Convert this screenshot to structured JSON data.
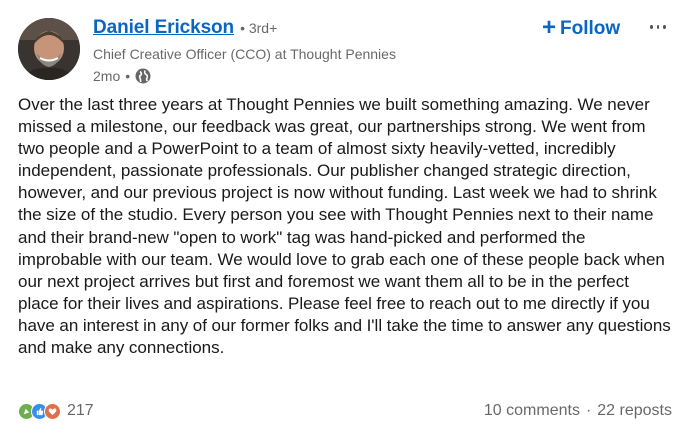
{
  "actor": {
    "name": "Daniel Erickson",
    "degree": "• 3rd+",
    "headline": "Chief Creative Officer (CCO) at Thought Pennies",
    "time": "2mo",
    "visibility_separator": "•"
  },
  "actions": {
    "follow_label": "Follow",
    "follow_icon": "+",
    "more_icon": "more-dots-icon"
  },
  "post": {
    "text": "Over the last three years at Thought Pennies we built something amazing. We never missed a milestone, our feedback was great, our partnerships strong. We went from two people and a PowerPoint to a team of almost sixty heavily-vetted, incredibly independent, passionate professionals. Our publisher changed strategic direction, however, and our previous project is now without funding. Last week we had to shrink the size of the studio. Every person you see with Thought Pennies next to their name and their brand-new \"open to work\" tag was hand-picked and performed the improbable with our team. We would love to grab each one of these people back when our next project arrives but first and foremost we want them all to be in the perfect place for their lives and aspirations. Please feel free to reach out to me directly if you have an interest in any of our former folks and I'll take the time to answer any questions and make any connections."
  },
  "social": {
    "reaction_count": "217",
    "reactions": [
      "celebrate-icon",
      "like-icon",
      "love-icon"
    ],
    "comments": "10 comments",
    "separator": "·",
    "reposts": "22 reposts"
  },
  "colors": {
    "link_blue": "#0a66c2",
    "secondary_text": "#666666",
    "celebrate": "#6dae4f",
    "like": "#378fe9",
    "love": "#df704d"
  }
}
